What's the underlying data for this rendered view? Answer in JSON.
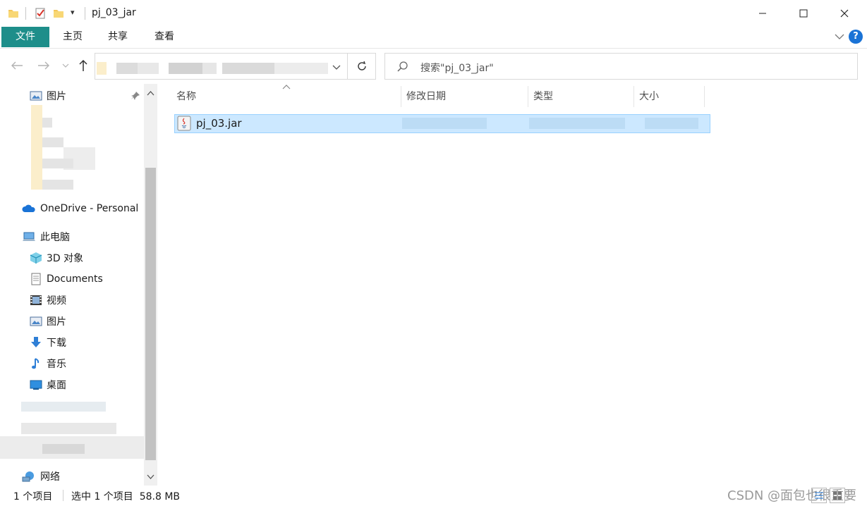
{
  "window": {
    "title": "pj_03_jar",
    "qat_dropdown": "▾"
  },
  "ribbon": {
    "tabs": [
      "文件",
      "主页",
      "共享",
      "查看"
    ],
    "help": "?"
  },
  "search": {
    "placeholder": "搜索\"pj_03_jar\""
  },
  "sidebar": {
    "items": [
      {
        "label": "图片",
        "icon": "pictures-icon"
      },
      {
        "label": "OneDrive - Personal",
        "icon": "onedrive-icon"
      },
      {
        "label": "此电脑",
        "icon": "this-pc-icon"
      },
      {
        "label": "3D 对象",
        "icon": "3d-objects-icon"
      },
      {
        "label": "Documents",
        "icon": "documents-icon"
      },
      {
        "label": "视频",
        "icon": "videos-icon"
      },
      {
        "label": "图片",
        "icon": "pictures-icon"
      },
      {
        "label": "下载",
        "icon": "download-icon"
      },
      {
        "label": "音乐",
        "icon": "music-icon"
      },
      {
        "label": "桌面",
        "icon": "desktop-icon"
      },
      {
        "label": "网络",
        "icon": "network-icon"
      }
    ]
  },
  "list": {
    "columns": [
      "名称",
      "修改日期",
      "类型",
      "大小"
    ],
    "files": [
      {
        "name": "pj_03.jar",
        "icon": "java-jar-icon",
        "selected": true
      }
    ]
  },
  "status": {
    "item_count": "1 个项目",
    "selection": "选中 1 个项目  58.8 MB",
    "watermark": "CSDN @面包也很重要"
  },
  "colors": {
    "file_tab": "#1e8e8a",
    "selection_bg": "#cce8ff",
    "selection_border": "#99d1ff",
    "accent_blue": "#1a73d6"
  }
}
